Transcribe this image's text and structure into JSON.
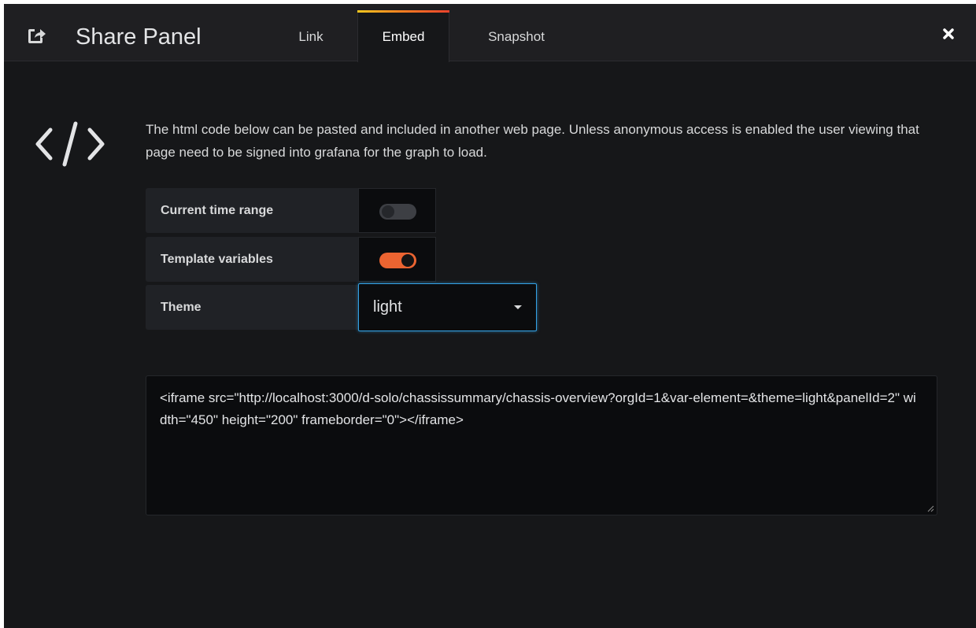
{
  "header": {
    "title": "Share Panel",
    "share_icon": "share-square-icon",
    "close_icon": "close-icon",
    "tabs": [
      {
        "label": "Link",
        "active": false
      },
      {
        "label": "Embed",
        "active": true
      },
      {
        "label": "Snapshot",
        "active": false
      }
    ]
  },
  "embed": {
    "icon": "code-icon",
    "info_text": "The html code below can be pasted and included in another web page. Unless anonymous access is enabled the user viewing that page need to be signed into grafana for the graph to load.",
    "options": [
      {
        "label": "Current time range",
        "checked": false
      },
      {
        "label": "Template variables",
        "checked": true
      }
    ],
    "theme": {
      "label": "Theme",
      "value": "light"
    },
    "code": "<iframe src=\"http://localhost:3000/d-solo/chassissummary/chassis-overview?orgId=1&var-element=&theme=light&panelId=2\" width=\"450\" height=\"200\" frameborder=\"0\"></iframe>"
  },
  "colors": {
    "background": "#161719",
    "header_bg": "#1f1f22",
    "accent_orange": "#eb6431",
    "focus_blue": "#33a2e5"
  }
}
